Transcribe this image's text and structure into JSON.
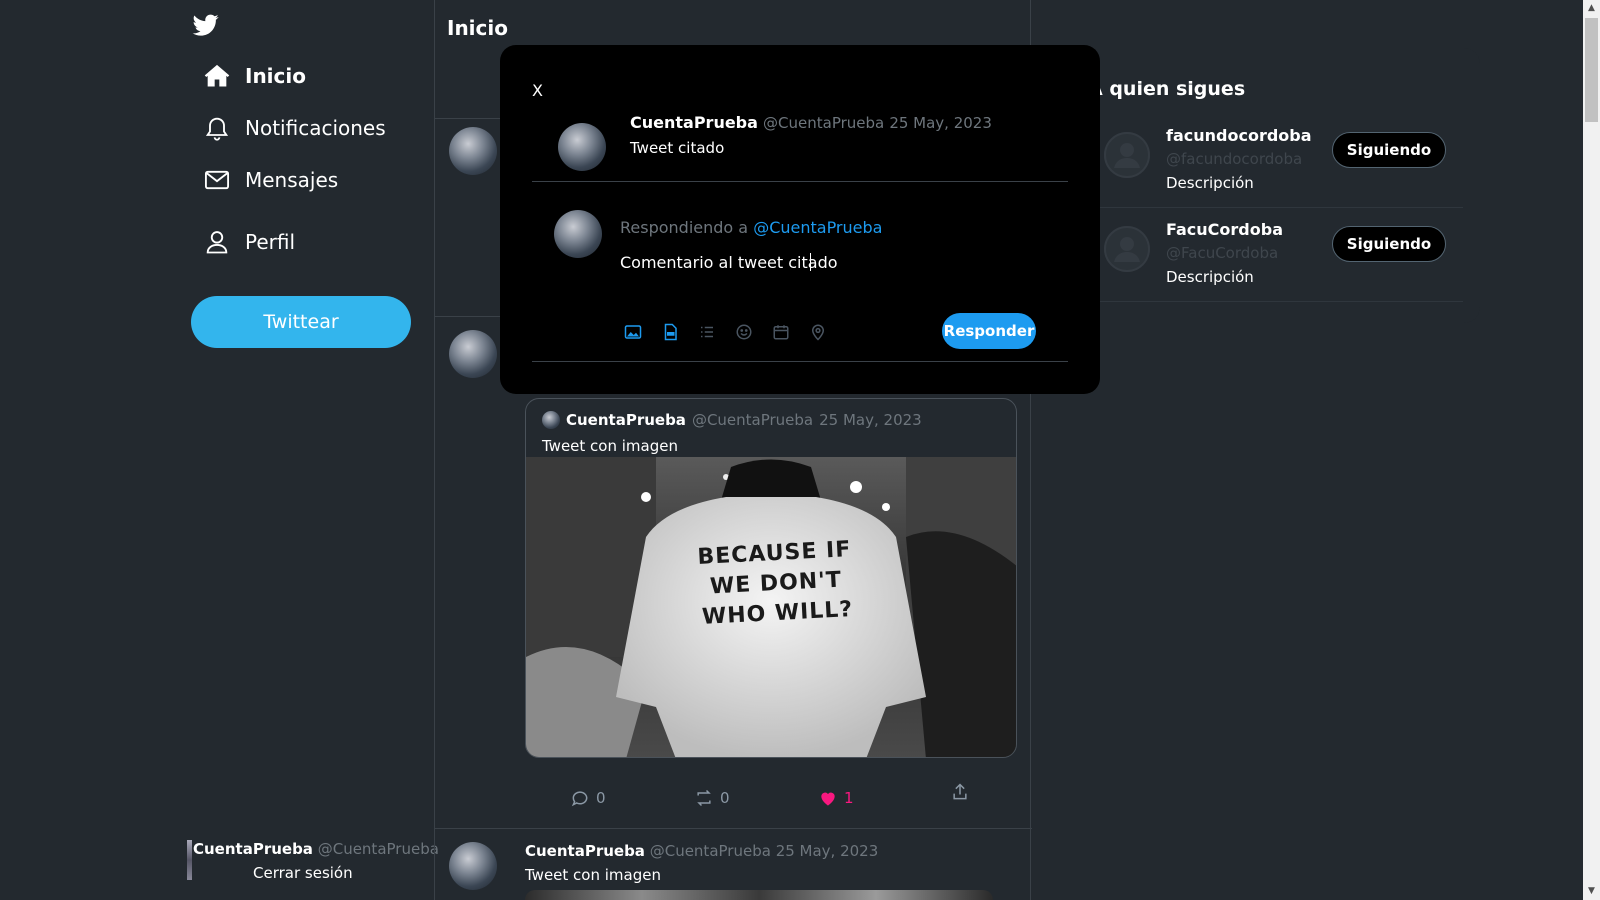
{
  "sidebar": {
    "nav": [
      {
        "label": "Inicio",
        "icon": "home-icon"
      },
      {
        "label": "Notificaciones",
        "icon": "bell-icon"
      },
      {
        "label": "Mensajes",
        "icon": "mail-icon"
      },
      {
        "label": "Perfil",
        "icon": "user-icon"
      }
    ],
    "tweet_button": "Twittear",
    "account": {
      "name": "CuentaPrueba",
      "handle": "@CuentaPrueba",
      "logout": "Cerrar sesión"
    }
  },
  "main": {
    "title": "Inicio",
    "quoted_tweet": {
      "name": "CuentaPrueba",
      "handle": "@CuentaPrueba",
      "date": "25 May, 2023",
      "text": "Tweet con imagen"
    },
    "image_caption_lines": [
      "BECAUSE IF",
      "WE DON'T",
      "WHO WILL?"
    ],
    "actions": {
      "comments": "0",
      "retweets": "0",
      "likes": "1"
    },
    "bottom_tweet": {
      "name": "CuentaPrueba",
      "handle": "@CuentaPrueba",
      "date": "25 May, 2023",
      "text": "Tweet con imagen"
    }
  },
  "right_panel": {
    "title": "A quien sigues",
    "follows": [
      {
        "name": "facundocordoba",
        "handle": "@facundocordoba",
        "description": "Descripción",
        "button": "Siguiendo"
      },
      {
        "name": "FacuCordoba",
        "handle": "@FacuCordoba",
        "description": "Descripción",
        "button": "Siguiendo"
      }
    ]
  },
  "modal": {
    "close": "X",
    "quoted": {
      "name": "CuentaPrueba",
      "handle": "@CuentaPrueba",
      "date": "25 May, 2023",
      "text": "Tweet citado"
    },
    "replying_prefix": "Respondiendo a",
    "replying_to": "@CuentaPrueba",
    "reply_value": "Comentario al tweet citado",
    "toolbar_icons": [
      "image-icon",
      "gif-icon",
      "poll-icon",
      "emoji-icon",
      "schedule-icon",
      "location-icon"
    ],
    "submit": "Responder"
  },
  "colors": {
    "accent": "#1d9bf0",
    "tweet_button": "#33b5ed",
    "background": "#23292f",
    "modal": "#000000",
    "like": "#f91880"
  }
}
